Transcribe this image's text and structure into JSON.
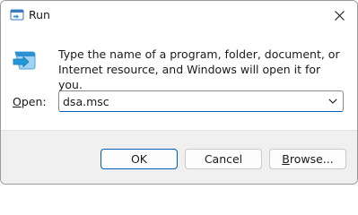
{
  "window": {
    "title": "Run",
    "icon": "run-app-icon",
    "close_icon": "close-icon"
  },
  "dialog": {
    "description": "Type the name of a program, folder, document, or Internet resource, and Windows will open it for you.",
    "open_label_prefix": "",
    "open_label_access": "O",
    "open_label_rest": "pen:",
    "open_value": "dsa.msc"
  },
  "buttons": {
    "ok": "OK",
    "cancel": "Cancel",
    "browse_access": "B",
    "browse_rest": "rowse..."
  },
  "colors": {
    "accent": "#005fb8",
    "footer": "#f0f0f0"
  }
}
